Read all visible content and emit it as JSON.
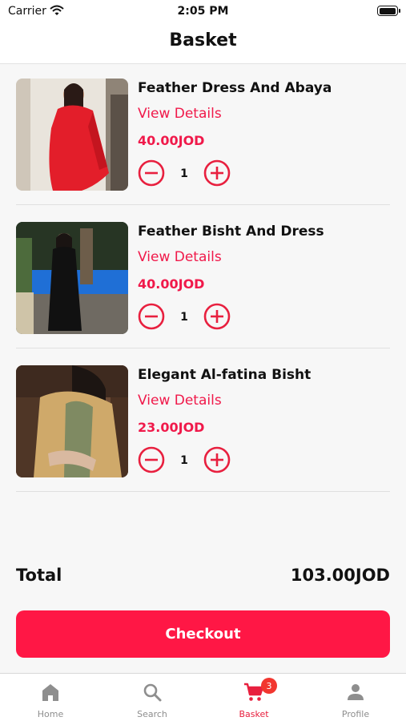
{
  "status_bar": {
    "carrier": "Carrier",
    "time": "2:05 PM",
    "battery_level": 1.0
  },
  "header": {
    "title": "Basket"
  },
  "basket": {
    "items": [
      {
        "name": "Feather Dress And Abaya",
        "details_label": "View Details",
        "price": "40.00JOD",
        "quantity": "1"
      },
      {
        "name": "Feather Bisht And Dress",
        "details_label": "View Details",
        "price": "40.00JOD",
        "quantity": "1"
      },
      {
        "name": "Elegant Al-fatina Bisht",
        "details_label": "View Details",
        "price": "23.00JOD",
        "quantity": "1"
      }
    ],
    "total_label": "Total",
    "total_value": "103.00JOD",
    "checkout_label": "Checkout"
  },
  "tab_bar": {
    "tabs": [
      {
        "label": "Home",
        "icon": "home-icon",
        "active": false
      },
      {
        "label": "Search",
        "icon": "search-icon",
        "active": false
      },
      {
        "label": "Basket",
        "icon": "cart-icon",
        "active": true,
        "badge": "3"
      },
      {
        "label": "Profile",
        "icon": "person-icon",
        "active": false
      }
    ]
  },
  "colors": {
    "accent": "#ff1745",
    "price": "#f0194a",
    "tab_active": "#e8203f",
    "tab_inactive": "#8e8e8e",
    "badge": "#f2362f"
  }
}
